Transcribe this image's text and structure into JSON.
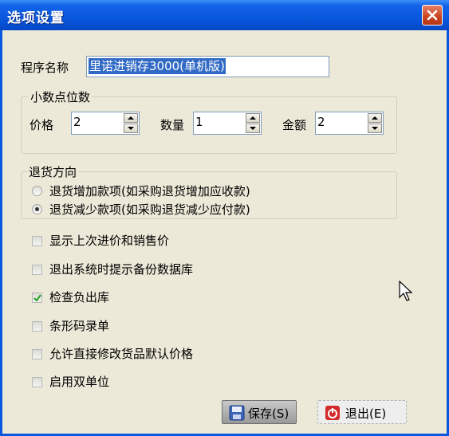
{
  "window": {
    "title": "选项设置"
  },
  "program_name": {
    "label": "程序名称",
    "value": "里诺进销存3000(单机版)"
  },
  "decimals": {
    "title": "小数点位数",
    "price": {
      "label": "价格",
      "value": "2"
    },
    "quantity": {
      "label": "数量",
      "value": "1"
    },
    "amount": {
      "label": "金额",
      "value": "2"
    }
  },
  "return_direction": {
    "title": "退货方向",
    "options": [
      {
        "label": "退货增加款项(如采购退货增加应收款)",
        "selected": false
      },
      {
        "label": "退货减少款项(如采购退货减少应付款)",
        "selected": true
      }
    ]
  },
  "checkboxes": [
    {
      "label": "显示上次进价和销售价",
      "checked": false
    },
    {
      "label": "退出系统时提示备份数据库",
      "checked": false
    },
    {
      "label": "检查负出库",
      "checked": true
    },
    {
      "label": "条形码录单",
      "checked": false
    },
    {
      "label": "允许直接修改货品默认价格",
      "checked": false
    },
    {
      "label": "启用双单位",
      "checked": false
    }
  ],
  "buttons": {
    "save": "保存(S)",
    "exit": "退出(E)"
  },
  "icons": {
    "close": "close-icon",
    "save": "save-icon",
    "exit": "power-icon",
    "cursor": "mouse-cursor-icon"
  }
}
